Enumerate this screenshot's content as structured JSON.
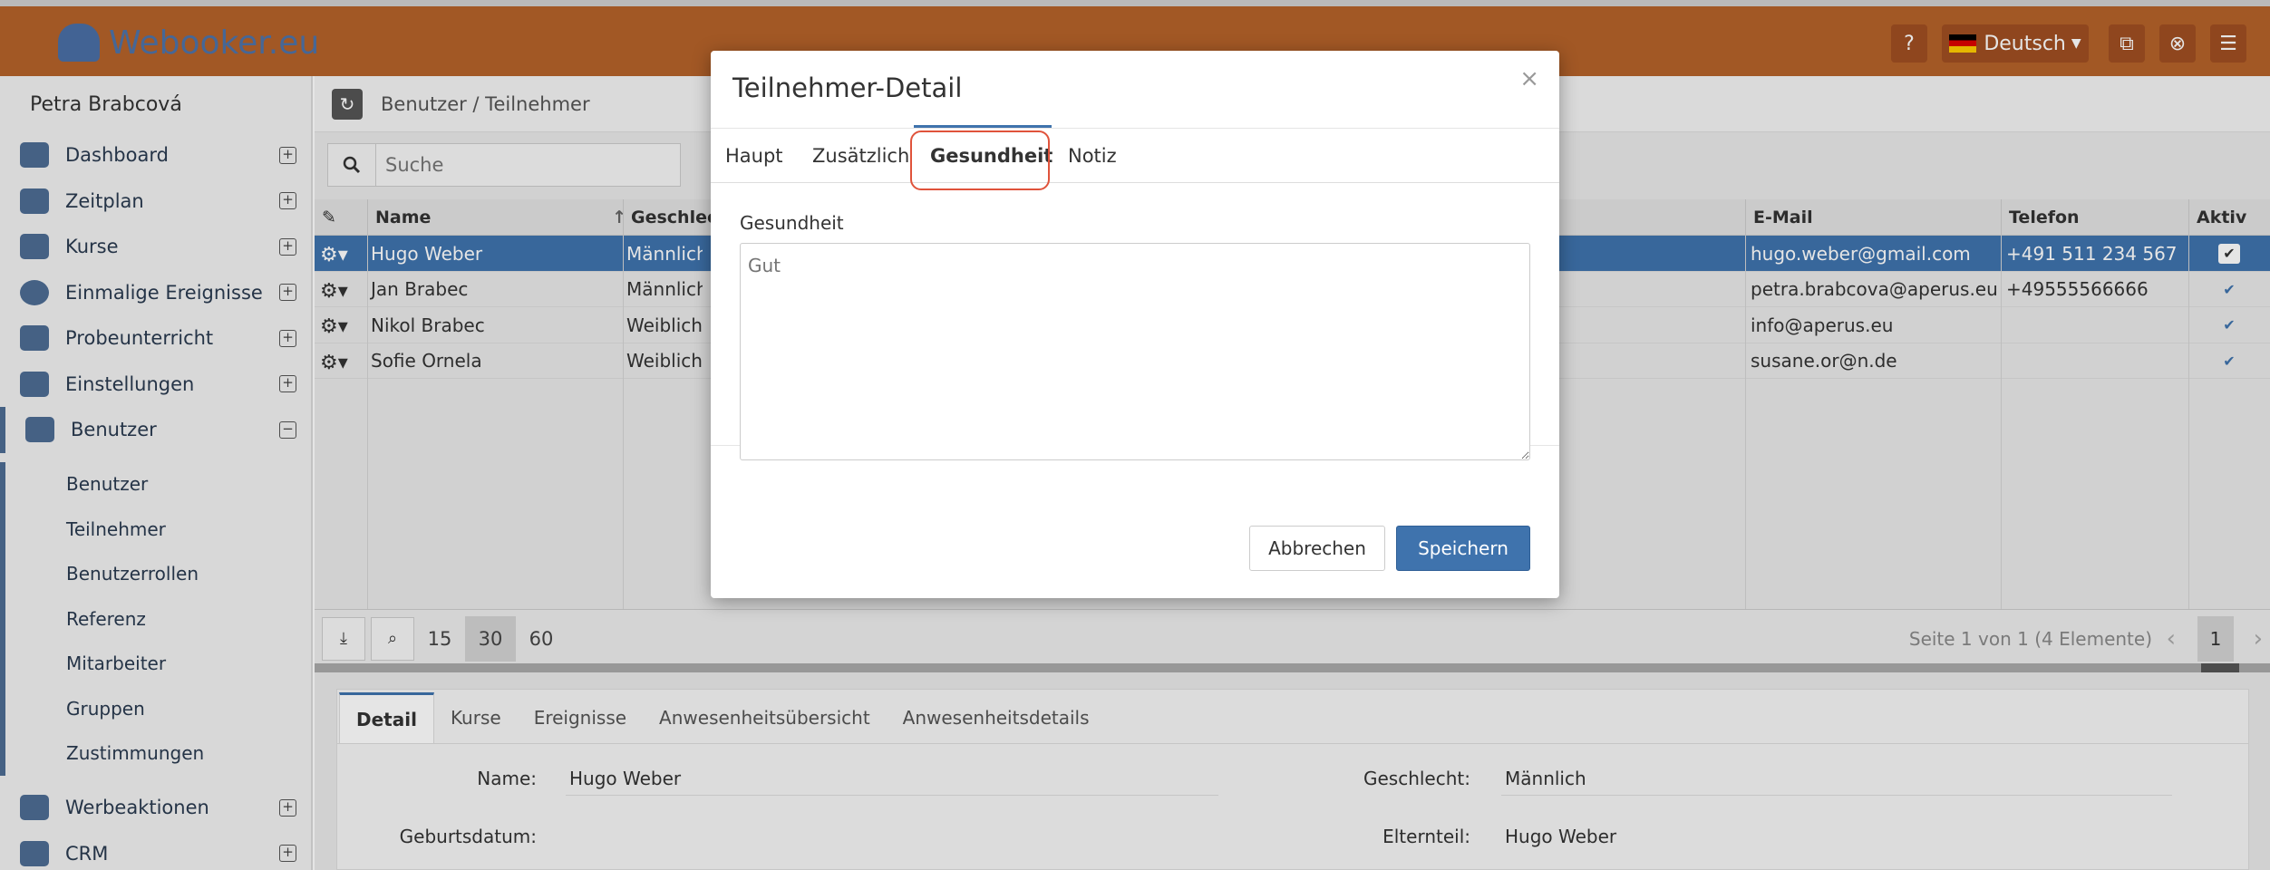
{
  "app": {
    "brand": "Webooker.eu",
    "language": "Deutsch"
  },
  "sidebar": {
    "user": "Petra Brabcová",
    "items": [
      {
        "label": "Dashboard"
      },
      {
        "label": "Zeitplan"
      },
      {
        "label": "Kurse"
      },
      {
        "label": "Einmalige Ereignisse"
      },
      {
        "label": "Probeunterricht"
      },
      {
        "label": "Einstellungen"
      },
      {
        "label": "Benutzer"
      }
    ],
    "subitems": [
      "Benutzer",
      "Teilnehmer",
      "Benutzerrollen",
      "Referenz",
      "Mitarbeiter",
      "Gruppen",
      "Zustimmungen"
    ],
    "after": [
      {
        "label": "Werbeaktionen"
      },
      {
        "label": "CRM"
      }
    ]
  },
  "breadcrumb": "Benutzer / Teilnehmer",
  "search": {
    "placeholder": "Suche"
  },
  "grid": {
    "headers": {
      "name": "Name",
      "gender": "Geschlecht",
      "email": "E-Mail",
      "phone": "Telefon",
      "active": "Aktiv"
    },
    "rows": [
      {
        "name": "Hugo Weber",
        "gender": "Männlich",
        "email": "hugo.weber@gmail.com",
        "phone": "+491 511 234 567",
        "active": true
      },
      {
        "name": "Jan Brabec",
        "gender": "Männlich",
        "email": "petra.brabcova@aperus.eu",
        "phone": "+49555566666",
        "active": true
      },
      {
        "name": "Nikol Brabec",
        "gender": "Weiblich",
        "email": "info@aperus.eu",
        "phone": "",
        "active": true
      },
      {
        "name": "Sofie Ornela",
        "gender": "Weiblich",
        "email": "susane.or@n.de",
        "phone": "",
        "active": true
      }
    ]
  },
  "pager": {
    "sizes": [
      "15",
      "30",
      "60"
    ],
    "active_size": "30",
    "info": "Seite 1 von 1 (4 Elemente)",
    "page": "1"
  },
  "detail": {
    "tabs": [
      "Detail",
      "Kurse",
      "Ereignisse",
      "Anwesenheitsübersicht",
      "Anwesenheitsdetails"
    ],
    "name_label": "Name:",
    "name_value": "Hugo Weber",
    "birth_label": "Geburtsdatum:",
    "gender_label": "Geschlecht:",
    "gender_value": "Männlich",
    "parent_label": "Elternteil:",
    "parent_value": "Hugo Weber"
  },
  "modal": {
    "title": "Teilnehmer-Detail",
    "close": "×",
    "tabs": [
      "Haupt",
      "Zusätzlich",
      "Gesundheit",
      "Notiz"
    ],
    "active_tab": "Gesundheit",
    "field_label": "Gesundheit",
    "field_value": "Gut",
    "cancel": "Abbrechen",
    "save": "Speichern"
  }
}
